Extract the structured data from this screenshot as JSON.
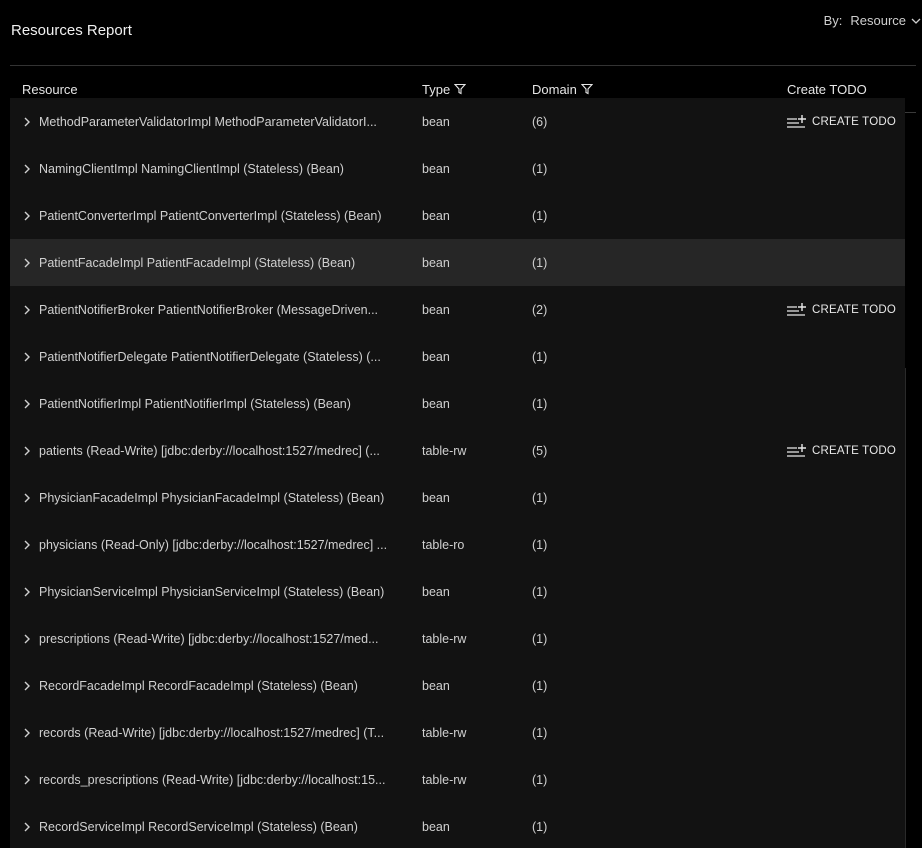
{
  "page": {
    "title": "Resources Report"
  },
  "group_by": {
    "label": "By:",
    "value": "Resource"
  },
  "columns": {
    "resource": "Resource",
    "type": "Type",
    "domain": "Domain",
    "todo": "Create TODO"
  },
  "rows": [
    {
      "name": "MethodParameterValidatorImpl MethodParameterValidatorI...",
      "type": "bean",
      "domain": "(6)",
      "todo": "CREATE TODO",
      "highlight": false
    },
    {
      "name": "NamingClientImpl NamingClientImpl (Stateless) (Bean)",
      "type": "bean",
      "domain": "(1)",
      "todo": "",
      "highlight": false
    },
    {
      "name": "PatientConverterImpl PatientConverterImpl (Stateless) (Bean)",
      "type": "bean",
      "domain": "(1)",
      "todo": "",
      "highlight": false
    },
    {
      "name": "PatientFacadeImpl PatientFacadeImpl (Stateless) (Bean)",
      "type": "bean",
      "domain": "(1)",
      "todo": "",
      "highlight": true
    },
    {
      "name": "PatientNotifierBroker PatientNotifierBroker (MessageDriven...",
      "type": "bean",
      "domain": "(2)",
      "todo": "CREATE TODO",
      "highlight": false
    },
    {
      "name": "PatientNotifierDelegate PatientNotifierDelegate (Stateless) (...",
      "type": "bean",
      "domain": "(1)",
      "todo": "",
      "highlight": false
    },
    {
      "name": "PatientNotifierImpl PatientNotifierImpl (Stateless) (Bean)",
      "type": "bean",
      "domain": "(1)",
      "todo": "",
      "highlight": false
    },
    {
      "name": "patients (Read-Write) [jdbc:derby://localhost:1527/medrec] (...",
      "type": "table-rw",
      "domain": "(5)",
      "todo": "CREATE TODO",
      "highlight": false
    },
    {
      "name": "PhysicianFacadeImpl PhysicianFacadeImpl (Stateless) (Bean)",
      "type": "bean",
      "domain": "(1)",
      "todo": "",
      "highlight": false
    },
    {
      "name": "physicians (Read-Only) [jdbc:derby://localhost:1527/medrec] ...",
      "type": "table-ro",
      "domain": "(1)",
      "todo": "",
      "highlight": false
    },
    {
      "name": "PhysicianServiceImpl PhysicianServiceImpl (Stateless) (Bean)",
      "type": "bean",
      "domain": "(1)",
      "todo": "",
      "highlight": false
    },
    {
      "name": "prescriptions (Read-Write) [jdbc:derby://localhost:1527/med...",
      "type": "table-rw",
      "domain": "(1)",
      "todo": "",
      "highlight": false
    },
    {
      "name": "RecordFacadeImpl RecordFacadeImpl (Stateless) (Bean)",
      "type": "bean",
      "domain": "(1)",
      "todo": "",
      "highlight": false
    },
    {
      "name": "records (Read-Write) [jdbc:derby://localhost:1527/medrec] (T...",
      "type": "table-rw",
      "domain": "(1)",
      "todo": "",
      "highlight": false
    },
    {
      "name": "records_prescriptions (Read-Write) [jdbc:derby://localhost:15...",
      "type": "table-rw",
      "domain": "(1)",
      "todo": "",
      "highlight": false
    },
    {
      "name": "RecordServiceImpl RecordServiceImpl (Stateless) (Bean)",
      "type": "bean",
      "domain": "(1)",
      "todo": "",
      "highlight": false
    }
  ]
}
